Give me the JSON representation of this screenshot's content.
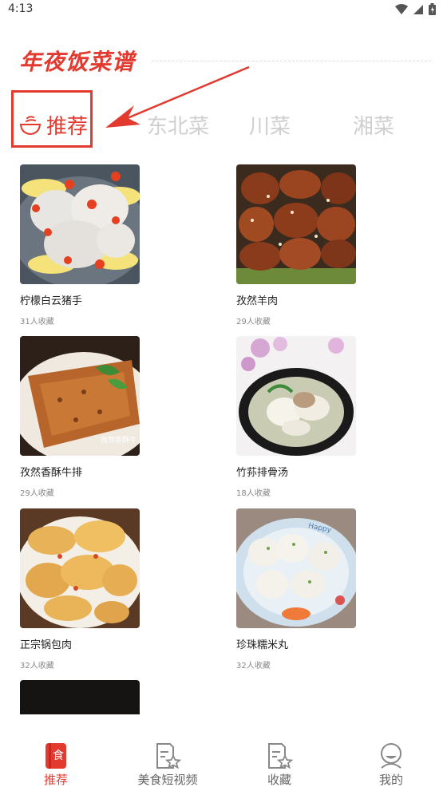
{
  "status_bar": {
    "time": "4:13"
  },
  "brand": {
    "title": "年夜饭菜谱"
  },
  "tabs": [
    {
      "label": "推荐",
      "active": true
    },
    {
      "label": "东北菜",
      "active": false
    },
    {
      "label": "川菜",
      "active": false
    },
    {
      "label": "湘菜",
      "active": false
    }
  ],
  "recipes": [
    {
      "name": "柠檬白云猪手",
      "favorites": "31人收藏"
    },
    {
      "name": "孜然羊肉",
      "favorites": "29人收藏"
    },
    {
      "name": "孜然香酥牛排",
      "favorites": "29人收藏",
      "photo_text": "孜然香酥牛"
    },
    {
      "name": "竹荪排骨汤",
      "favorites": "18人收藏"
    },
    {
      "name": "正宗锅包肉",
      "favorites": "32人收藏"
    },
    {
      "name": "珍珠糯米丸",
      "favorites": "32人收藏",
      "photo_text": "Happy"
    }
  ],
  "bottom_nav": [
    {
      "label": "推荐",
      "icon": "recipe-book-icon",
      "active": true
    },
    {
      "label": "美食短视频",
      "icon": "video-star-icon",
      "active": false
    },
    {
      "label": "收藏",
      "icon": "favorite-star-icon",
      "active": false
    },
    {
      "label": "我的",
      "icon": "profile-icon",
      "active": false
    }
  ],
  "colors": {
    "accent": "#e23a2f",
    "inactive_tab": "#cfcfcf"
  }
}
